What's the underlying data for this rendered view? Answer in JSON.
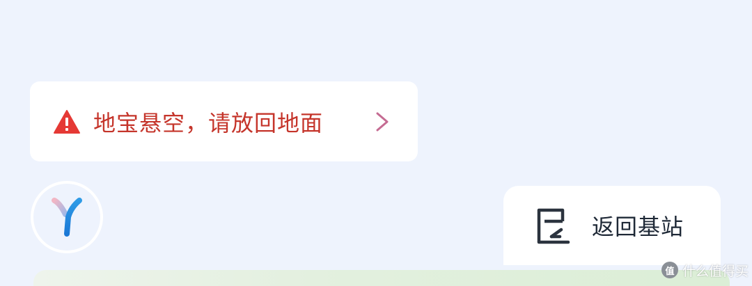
{
  "alert": {
    "icon": "warning-triangle-icon",
    "message": "地宝悬空，请放回地面",
    "chevron": ">",
    "color": "#c5352b"
  },
  "avatar": {
    "icon": "y-logo-icon"
  },
  "base_button": {
    "icon": "return-to-base-icon",
    "label": "返回基站"
  },
  "watermark": {
    "badge": "值",
    "text": "什么值得买"
  }
}
